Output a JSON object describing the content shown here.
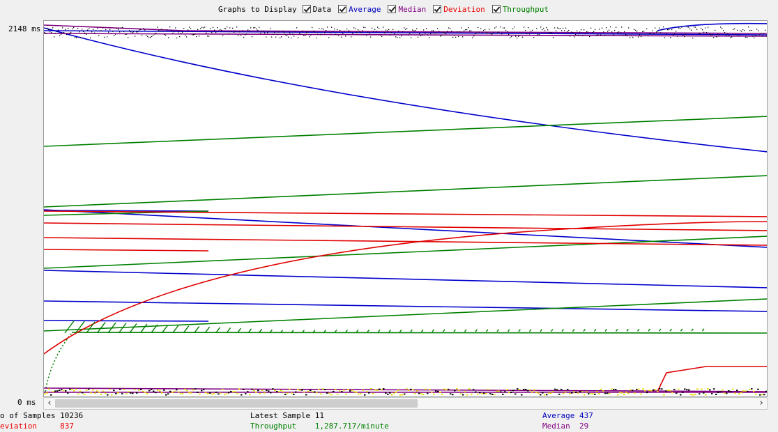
{
  "legend": {
    "title": "Graphs to Display",
    "options": [
      {
        "label": "Data",
        "color": "#000000",
        "checked": true
      },
      {
        "label": "Average",
        "color": "#0000cc",
        "checked": true
      },
      {
        "label": "Median",
        "color": "#800080",
        "checked": true
      },
      {
        "label": "Deviation",
        "color": "#e00000",
        "checked": true
      },
      {
        "label": "Throughput",
        "color": "#008000",
        "checked": true
      }
    ]
  },
  "axis": {
    "top_label": "2148 ms",
    "bottom_label": "0 ms"
  },
  "stats": {
    "samples_label": "o of Samples",
    "samples_value": "10236",
    "latest_label": "Latest Sample",
    "latest_value": "11",
    "average_label": "Average",
    "average_value": "437",
    "deviation_label": "eviation",
    "deviation_value": "837",
    "throughput_label": "Throughput",
    "throughput_value": "1,287.717/minute",
    "median_label": "Median",
    "median_value": "29"
  },
  "chart_data": {
    "type": "line",
    "ylim": [
      0,
      2148
    ],
    "ylabel_top": "2148 ms",
    "ylabel_bottom": "0 ms",
    "series": [
      {
        "name": "Data",
        "color": "#000000"
      },
      {
        "name": "Average",
        "color": "#0000cc"
      },
      {
        "name": "Median",
        "color": "#800080"
      },
      {
        "name": "Deviation",
        "color": "#e00000"
      },
      {
        "name": "Throughput",
        "color": "#008000"
      }
    ],
    "summary": {
      "samples": 10236,
      "latest": 11,
      "average": 437,
      "deviation": 837,
      "median": 29,
      "throughput_per_minute": 1287.717
    }
  }
}
